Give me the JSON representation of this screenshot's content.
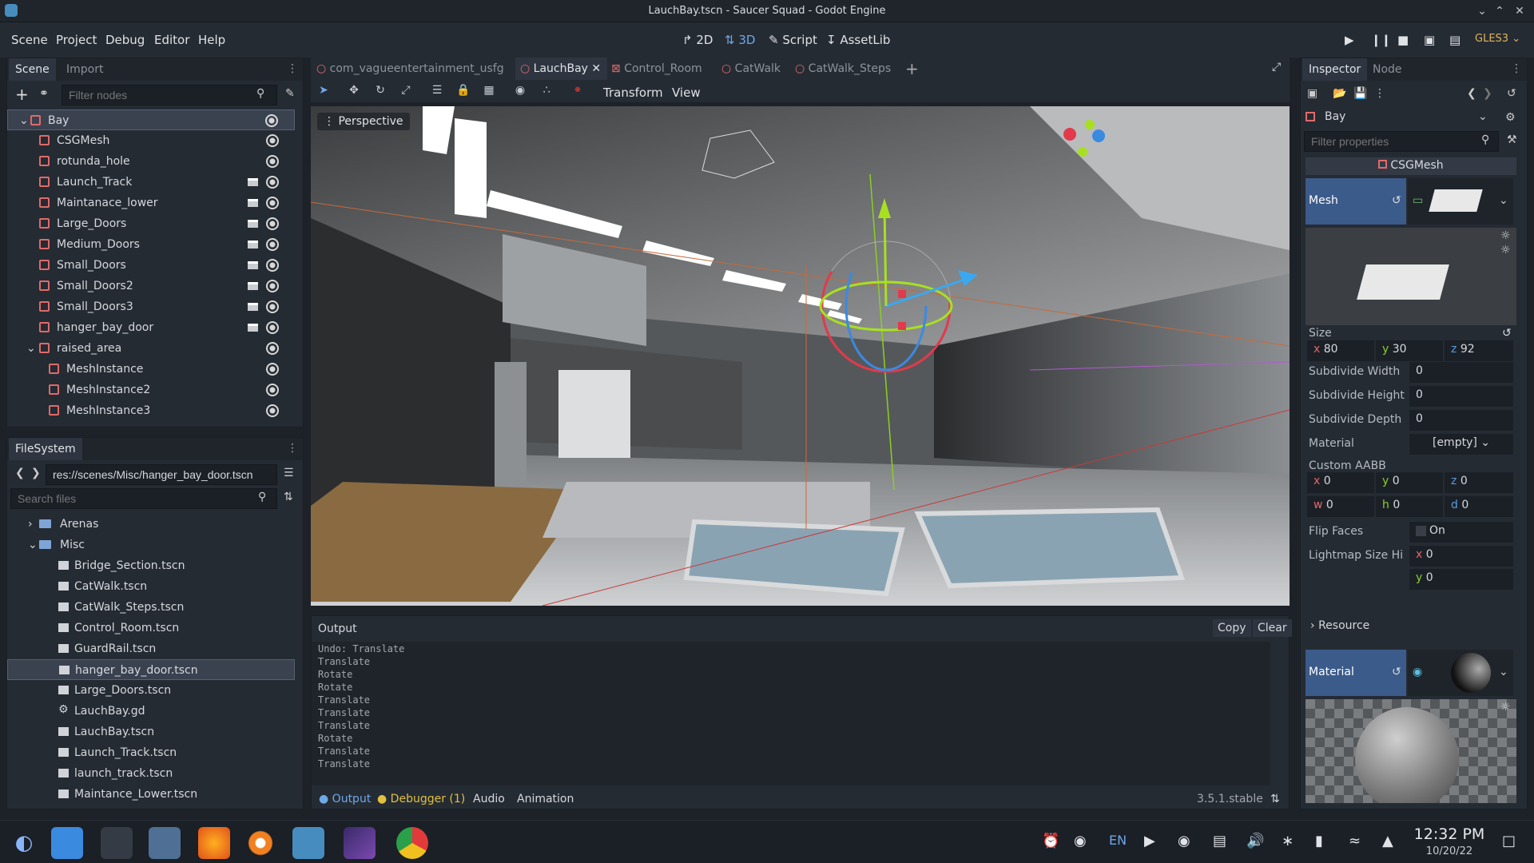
{
  "window": {
    "title": "LauchBay.tscn - Saucer Squad - Godot Engine"
  },
  "menu": {
    "scene": "Scene",
    "project": "Project",
    "debug": "Debug",
    "editor": "Editor",
    "help": "Help"
  },
  "modes": {
    "d2": "2D",
    "d3": "3D",
    "script": "Script",
    "assetlib": "AssetLib",
    "renderer": "GLES3"
  },
  "scene_dock": {
    "tab_scene": "Scene",
    "tab_import": "Import",
    "filter_placeholder": "Filter nodes",
    "nodes": [
      {
        "label": "Bay",
        "depth": 0,
        "clap": false
      },
      {
        "label": "CSGMesh",
        "depth": 1,
        "clap": false
      },
      {
        "label": "rotunda_hole",
        "depth": 1,
        "clap": false
      },
      {
        "label": "Launch_Track",
        "depth": 1,
        "clap": true
      },
      {
        "label": "Maintanace_lower",
        "depth": 1,
        "clap": true
      },
      {
        "label": "Large_Doors",
        "depth": 1,
        "clap": true
      },
      {
        "label": "Medium_Doors",
        "depth": 1,
        "clap": true
      },
      {
        "label": "Small_Doors",
        "depth": 1,
        "clap": true
      },
      {
        "label": "Small_Doors2",
        "depth": 1,
        "clap": true
      },
      {
        "label": "Small_Doors3",
        "depth": 1,
        "clap": true
      },
      {
        "label": "hanger_bay_door",
        "depth": 1,
        "clap": true
      },
      {
        "label": "raised_area",
        "depth": 1,
        "clap": false
      },
      {
        "label": "MeshInstance",
        "depth": 2,
        "clap": false
      },
      {
        "label": "MeshInstance2",
        "depth": 2,
        "clap": false
      },
      {
        "label": "MeshInstance3",
        "depth": 2,
        "clap": false
      }
    ]
  },
  "filesystem": {
    "tab": "FileSystem",
    "path": "res://scenes/Misc/hanger_bay_door.tscn",
    "search_placeholder": "Search files",
    "items": [
      {
        "label": "Arenas",
        "type": "folder",
        "depth": 0
      },
      {
        "label": "Misc",
        "type": "folder",
        "depth": 0
      },
      {
        "label": "Bridge_Section.tscn",
        "type": "scene",
        "depth": 1
      },
      {
        "label": "CatWalk.tscn",
        "type": "scene",
        "depth": 1
      },
      {
        "label": "CatWalk_Steps.tscn",
        "type": "scene",
        "depth": 1
      },
      {
        "label": "Control_Room.tscn",
        "type": "scene",
        "depth": 1
      },
      {
        "label": "GuardRail.tscn",
        "type": "scene",
        "depth": 1
      },
      {
        "label": "hanger_bay_door.tscn",
        "type": "scene",
        "depth": 1
      },
      {
        "label": "Large_Doors.tscn",
        "type": "scene",
        "depth": 1
      },
      {
        "label": "LauchBay.gd",
        "type": "script",
        "depth": 1
      },
      {
        "label": "LauchBay.tscn",
        "type": "scene",
        "depth": 1
      },
      {
        "label": "Launch_Track.tscn",
        "type": "scene",
        "depth": 1
      },
      {
        "label": "launch_track.tscn",
        "type": "scene",
        "depth": 1
      },
      {
        "label": "Maintance_Lower.tscn",
        "type": "scene",
        "depth": 1
      }
    ]
  },
  "editor_tabs": [
    "com_vagueentertainment_usfg",
    "LauchBay",
    "Control_Room",
    "CatWalk",
    "CatWalk_Steps"
  ],
  "viewport": {
    "perspective": "Perspective",
    "transform": "Transform",
    "view": "View"
  },
  "output": {
    "title": "Output",
    "copy": "Copy",
    "clear": "Clear",
    "lines": [
      "Undo: Translate",
      "Translate",
      "Rotate",
      "Rotate",
      "Translate",
      "Translate",
      "Translate",
      "Rotate",
      "Translate",
      "Translate"
    ]
  },
  "bottom_tabs": {
    "output": "Output",
    "debugger": "Debugger (1)",
    "audio": "Audio",
    "animation": "Animation",
    "version": "3.5.1.stable"
  },
  "inspector": {
    "tab_inspector": "Inspector",
    "tab_node": "Node",
    "object": "Bay",
    "filter_placeholder": "Filter properties",
    "class_name": "CSGMesh",
    "mesh_label": "Mesh",
    "size_label": "Size",
    "size": {
      "x": "80",
      "y": "30",
      "z": "92"
    },
    "subdivide_width": {
      "label": "Subdivide Width",
      "value": "0"
    },
    "subdivide_height": {
      "label": "Subdivide Height",
      "value": "0"
    },
    "subdivide_depth": {
      "label": "Subdivide Depth",
      "value": "0"
    },
    "material": {
      "label": "Material",
      "value": "[empty]"
    },
    "custom_aabb": {
      "label": "Custom AABB",
      "x": "0",
      "y": "0",
      "z": "0",
      "w": "0",
      "h": "0",
      "d": "0"
    },
    "flip_faces": {
      "label": "Flip Faces",
      "value": "On"
    },
    "lightmap": {
      "label": "Lightmap Size Hi",
      "x": "0",
      "y": "0"
    },
    "resource": "Resource",
    "material_section": "Material"
  },
  "taskbar": {
    "lang": "EN",
    "time": "12:32 PM",
    "date": "10/20/22"
  },
  "colors": {
    "accent": "#5b9bd9",
    "bg": "#252b33",
    "selection": "#3a4250"
  }
}
